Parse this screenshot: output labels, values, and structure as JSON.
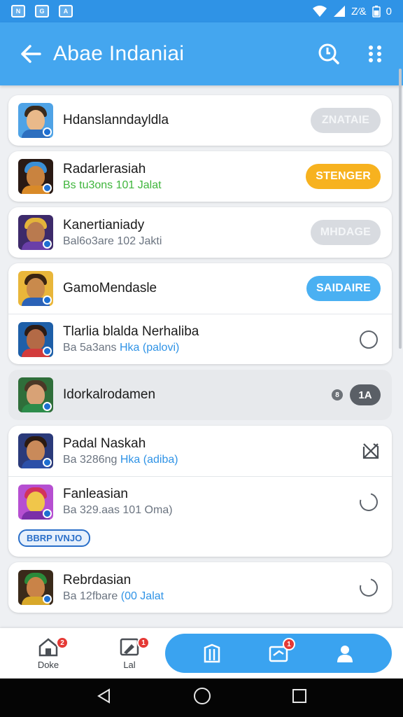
{
  "status_bar": {
    "notif_icons": [
      "N",
      "G",
      "A"
    ],
    "right_text": "Z⁄᠎&",
    "battery_text": "0",
    "icons": [
      "wifi-icon",
      "signal-icon",
      "battery-icon"
    ]
  },
  "app_bar": {
    "title": "Abae Indaniai",
    "color": "#44a6ef"
  },
  "list": [
    {
      "title": "Hdanslanndayldla",
      "subtitle": "",
      "action": "ZNATAIE",
      "action_style": "gray",
      "avatar": {
        "bg": "#4fa3e6",
        "skin": "#e9b98a",
        "hair": "#3a2a1c",
        "body": "#2d6fbf"
      }
    },
    {
      "title": "Radarlerasiah",
      "subtitle": "Bs tu3ons 101 Jalat",
      "subtitle_style": "green",
      "action": "STENGER",
      "action_style": "orange",
      "avatar": {
        "bg": "#2a1a14",
        "skin": "#c9833f",
        "hair": "#3a8fd6",
        "body": "#d98a28"
      }
    },
    {
      "title": "Kanertianiady",
      "subtitle": "Bal6o3are 102 Jakti",
      "subtitle_highlight": "102 Jakti",
      "action": "MHDAGE",
      "action_style": "gray",
      "avatar": {
        "bg": "#3d2a6a",
        "skin": "#b97a4f",
        "hair": "#e3b43a",
        "body": "#6a3fa8"
      }
    }
  ],
  "group_card": [
    {
      "title": "GamoMendasle",
      "subtitle": "",
      "action": "SAIDAIRE",
      "action_style": "blue",
      "avatar": {
        "bg": "#e9b63a",
        "skin": "#c98a4c",
        "hair": "#3a2412",
        "body": "#2b62b7"
      }
    },
    {
      "title": "Tlarlia blalda Nerhaliba",
      "subtitle_prefix": "Ba 5a3ans",
      "subtitle_highlight": "Hka (palovi)",
      "control": "radio-off",
      "avatar": {
        "bg": "#1e5fa8",
        "skin": "#b36a46",
        "hair": "#2c1c16",
        "body": "#d23b3b"
      }
    }
  ],
  "muted_row": {
    "title": "Idorkalrodamen",
    "count_small": "8",
    "count_pill": "1A",
    "avatar": {
      "bg": "#2f6e3a",
      "skin": "#d8a276",
      "hair": "#4a3826",
      "body": "#2c8c4a"
    }
  },
  "card_three": [
    {
      "title": "Padal Naskah",
      "subtitle_prefix": "Ba 3286ng",
      "subtitle_highlight": "Hka (adiba)",
      "control": "close-box-icon",
      "avatar": {
        "bg": "#2a3a7a",
        "skin": "#c98a5a",
        "hair": "#2a1a12",
        "body": "#2b4fa8"
      }
    },
    {
      "title": "Fanleasian",
      "subtitle_prefix": "Ba 329.aas 101 Oma)",
      "subtitle_highlight": "",
      "control": "refresh-ring",
      "avatar": {
        "bg": "#b64fd1",
        "skin": "#f0c64a",
        "hair": "#d2335c",
        "body": "#7b2fa8"
      }
    }
  ],
  "tag_label": "BBRP IVNJO",
  "last_card": {
    "title": "Rebrdasian",
    "subtitle_prefix": "Ba 12fbare",
    "subtitle_highlight": "(00 Jalat",
    "control": "refresh-ring",
    "avatar": {
      "bg": "#3a2a1a",
      "skin": "#c98348",
      "hair": "#2a8a3a",
      "body": "#d8a82a"
    }
  },
  "bottom_nav": {
    "home": {
      "label": "Doke",
      "badge": "2",
      "icon": "home-icon"
    },
    "second": {
      "label": "Lal",
      "badge": "1",
      "icon": "edit-icon"
    },
    "pill": [
      {
        "icon": "library-icon",
        "badge": ""
      },
      {
        "icon": "message-icon",
        "badge": "1"
      },
      {
        "icon": "person-icon",
        "badge": ""
      }
    ]
  },
  "system_nav": [
    "back-icon",
    "home-circle-icon",
    "recents-icon"
  ]
}
